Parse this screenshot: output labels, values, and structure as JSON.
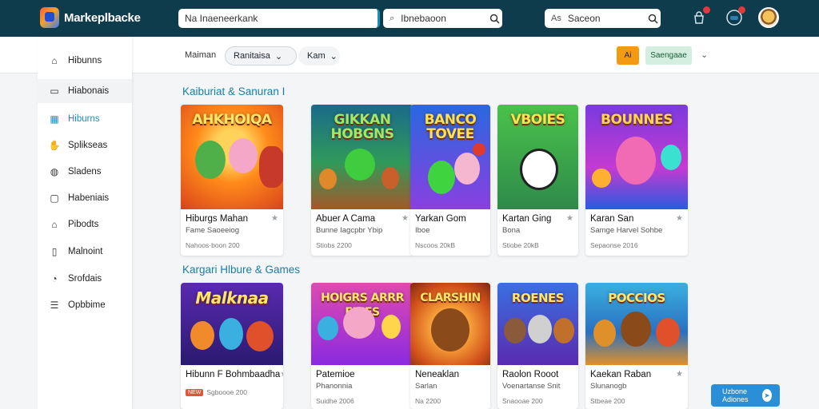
{
  "app": {
    "brand": "Markeplbacke"
  },
  "header": {
    "search_main": "Na Inaeneerkank",
    "search_secondary": {
      "prefix": "⌕",
      "text": "Ibnebaoon"
    },
    "search_right": {
      "prefix": "As",
      "text": "Saceon"
    },
    "icons": [
      "bag-icon",
      "trophy-icon",
      "gamepad-icon"
    ]
  },
  "subheader": {
    "label": "Maiman",
    "filter1": "Ranitaisa",
    "filter2": "Kam",
    "orange_button": "Ai",
    "green_button": "Saengaae"
  },
  "sidebar": {
    "items": [
      {
        "label": "Hibunns",
        "icon": "home-icon"
      },
      {
        "label": "Hiabonais",
        "icon": "document-icon",
        "active": true
      },
      {
        "label": "Hiburns",
        "icon": "grid-icon",
        "link": true,
        "prefix": "Gid"
      },
      {
        "label": "Splikseas",
        "icon": "hand-icon"
      },
      {
        "label": "Sladens",
        "icon": "globe-icon"
      },
      {
        "label": "Habeniais",
        "icon": "square-icon"
      },
      {
        "label": "Pibodts",
        "icon": "house-icon"
      },
      {
        "label": "Malnoint",
        "icon": "tablet-icon"
      },
      {
        "label": "Srofdais",
        "icon": "chart-icon"
      },
      {
        "label": "Opbbime",
        "icon": "list-icon"
      }
    ]
  },
  "sections": [
    {
      "title": "Kaiburiat & Sanuran I",
      "cards": [
        {
          "art": "AHKHOIQA",
          "name": "Hiburgs Mahan",
          "sub": "Fame Saoeeiog",
          "meta": "Nahoos·boon 200"
        },
        {
          "art": "GIKKAN HOBGNS",
          "name": "Abuer A Cama",
          "sub": "Bunne Iagcpbr Ybip",
          "meta": "Stiobs 2200"
        },
        {
          "art": "BANCO TOVEE",
          "name": "Yarkan Gom",
          "sub": "Iboe",
          "meta": "Nscoos 20kB"
        },
        {
          "art": "VBOIES",
          "name": "Kartan Ging",
          "sub": "Bona",
          "meta": "Stiobe 20kB"
        },
        {
          "art": "BOUNNES",
          "name": "Karan San",
          "sub": "Samge Harvel Sohbe",
          "meta": "Sepaonse 2016"
        }
      ]
    },
    {
      "title": "Kargari Hlbure & Games",
      "cards": [
        {
          "art": "Malknaa",
          "name": "Hibunn F Bohmbaadha",
          "sub": "",
          "meta": "Sgboooe 200",
          "tag": "NEW"
        },
        {
          "art": "HOIGRS ARRR EUIES",
          "name": "Patemioe",
          "sub": "Phanonnia",
          "meta": "Suidhe 2006"
        },
        {
          "art": "CLARSHIN",
          "name": "Neneaklan",
          "sub": "Sarlan",
          "meta": "Na 2200"
        },
        {
          "art": "ROENES",
          "name": "Raolon Rooot",
          "sub": "Voenartanse Snit",
          "meta": "Snaooae 200"
        },
        {
          "art": "POCCIOS",
          "name": "Kaekan Raban",
          "sub": "Slunanogb",
          "meta": "Stbeae 200"
        }
      ]
    }
  ],
  "chat": {
    "label": "Uzbone Adiones"
  },
  "colors": {
    "header": "#0f3c4c",
    "accent": "#1a8fb8",
    "orange": "#f29a12",
    "green": "#d4efe0"
  }
}
